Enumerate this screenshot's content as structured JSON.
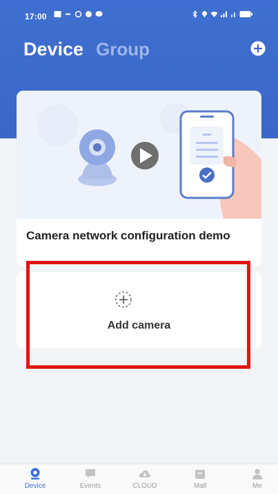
{
  "status_bar": {
    "time": "17:00"
  },
  "header": {
    "tab_device": "Device",
    "tab_group": "Group",
    "add_icon": "plus-circle-icon"
  },
  "demo_card": {
    "title": "Camera network configuration demo"
  },
  "add_card": {
    "label": "Add camera",
    "icon": "dashed-plus-icon"
  },
  "nav": {
    "items": [
      {
        "label": "Device",
        "icon": "camera-icon",
        "active": true
      },
      {
        "label": "Events",
        "icon": "message-icon",
        "active": false
      },
      {
        "label": "CLOUD",
        "icon": "cloud-icon",
        "active": false
      },
      {
        "label": "Mall",
        "icon": "shop-icon",
        "active": false
      },
      {
        "label": "Me",
        "icon": "person-icon",
        "active": false
      }
    ]
  },
  "colors": {
    "header_blue": "#3a66c7",
    "accent_blue": "#3b6bd1",
    "highlight_red": "#e01515"
  }
}
